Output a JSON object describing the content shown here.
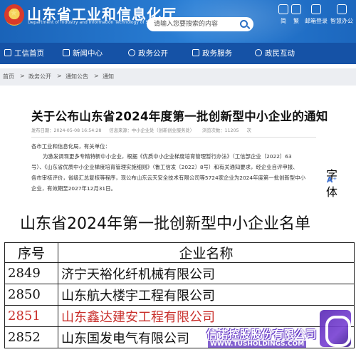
{
  "header": {
    "title": "山东省工业和信息化厅",
    "subtitle": "Department of Industry and Information Technology of Shandong Province",
    "search_placeholder": "请输入您要搜索的内容",
    "tools": [
      {
        "label": "简",
        "icon": "simplified-icon"
      },
      {
        "label": "繁",
        "icon": "traditional-icon"
      },
      {
        "label": "邮箱登录",
        "icon": "mail-icon"
      },
      {
        "label": "智慧办公",
        "icon": "office-icon"
      }
    ]
  },
  "nav": {
    "items": [
      "工信首页",
      "新闻中心",
      "政务公开",
      "政务服务",
      "政民互动"
    ],
    "icons": [
      "home-icon",
      "news-icon",
      "info-icon",
      "service-icon",
      "interact-icon"
    ]
  },
  "breadcrumb": [
    "首页",
    "政务公开",
    "通知公告",
    "通知"
  ],
  "article": {
    "title": "关于公布山东省2024年度第一批创新型中小企业的通知",
    "meta": {
      "date": "发布日期：2024-05-08 16:54:28",
      "source": "信息来源：中小企业处（创新创业服务处）",
      "views": "浏览次数：11205",
      "unit": "次"
    },
    "paragraphs": [
      "各市工业和信息化局，有关单位：",
      "为激发调现更多专精特新中小企业，根据《优质中小企业梯度培育管理暂行办法》（工信部企业〔2022〕63",
      "号）、《山东省优质中小企业梯度培育管理实施细则》（鲁工信发〔2022〕8号）和有关通知要求，经企业自评申报、",
      "各市审核评价，省级汇总复核等程序，现公布山东云天安全技术有限公司等5724家企业为2024年度第一批创新型中小",
      "企业，有效期至2027年12月31日。"
    ],
    "side_label": "字体",
    "font_big": "A⁺",
    "font_small": "A⁻"
  },
  "document": {
    "title": "山东省2024年第一批创新型中小企业名单",
    "headers": [
      "序号",
      "企业名称"
    ],
    "rows": [
      {
        "no": "2849",
        "name": "济宁天裕化纤机械有限公司"
      },
      {
        "no": "2850",
        "name": "山东航大楼宇工程有限公司"
      },
      {
        "no": "2851",
        "name": "山东鑫达建安工程有限公司"
      },
      {
        "no": "2852",
        "name": "山东国发电气有限公司"
      }
    ],
    "highlight_color": "#c9302c"
  },
  "watermark": {
    "text": "信诺控股股份有限公司",
    "url": "WWW.TUSHOLDINGS.COM"
  }
}
